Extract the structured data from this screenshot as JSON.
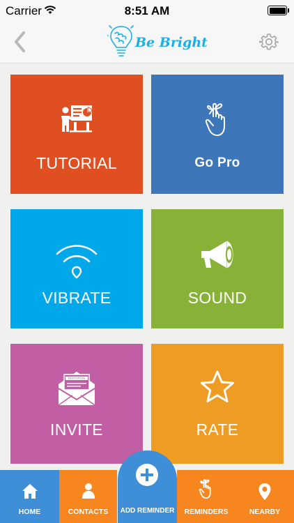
{
  "status_bar": {
    "carrier": "Carrier",
    "time": "8:51 AM",
    "battery_level": 1.0
  },
  "nav": {
    "back_icon": "chevron-left-icon",
    "logo_text": "Be Bright",
    "settings_icon": "gear-icon"
  },
  "tiles": [
    {
      "label": "TUTORIAL",
      "icon": "presentation-icon",
      "color": "#df4f22"
    },
    {
      "label": "Go Pro",
      "icon": "finger-ribbon-icon",
      "color": "#3e76ba"
    },
    {
      "label": "VIBRATE",
      "icon": "vibrate-signal-icon",
      "color": "#00a8ea"
    },
    {
      "label": "SOUND",
      "icon": "megaphone-icon",
      "color": "#88b237"
    },
    {
      "label": "INVITE",
      "icon": "invitation-envelope-icon",
      "color": "#c25fa4",
      "icon_text": "INVITATION"
    },
    {
      "label": "RATE",
      "icon": "star-icon",
      "color": "#ee9c24"
    }
  ],
  "tab_bar": {
    "home": "HOME",
    "contacts": "CONTACTS",
    "add_reminder": "ADD REMINDER",
    "reminders": "REMINDERS",
    "nearby": "NEARBY",
    "active_color": "#3e8fd8",
    "inactive_color": "#f7861f"
  }
}
